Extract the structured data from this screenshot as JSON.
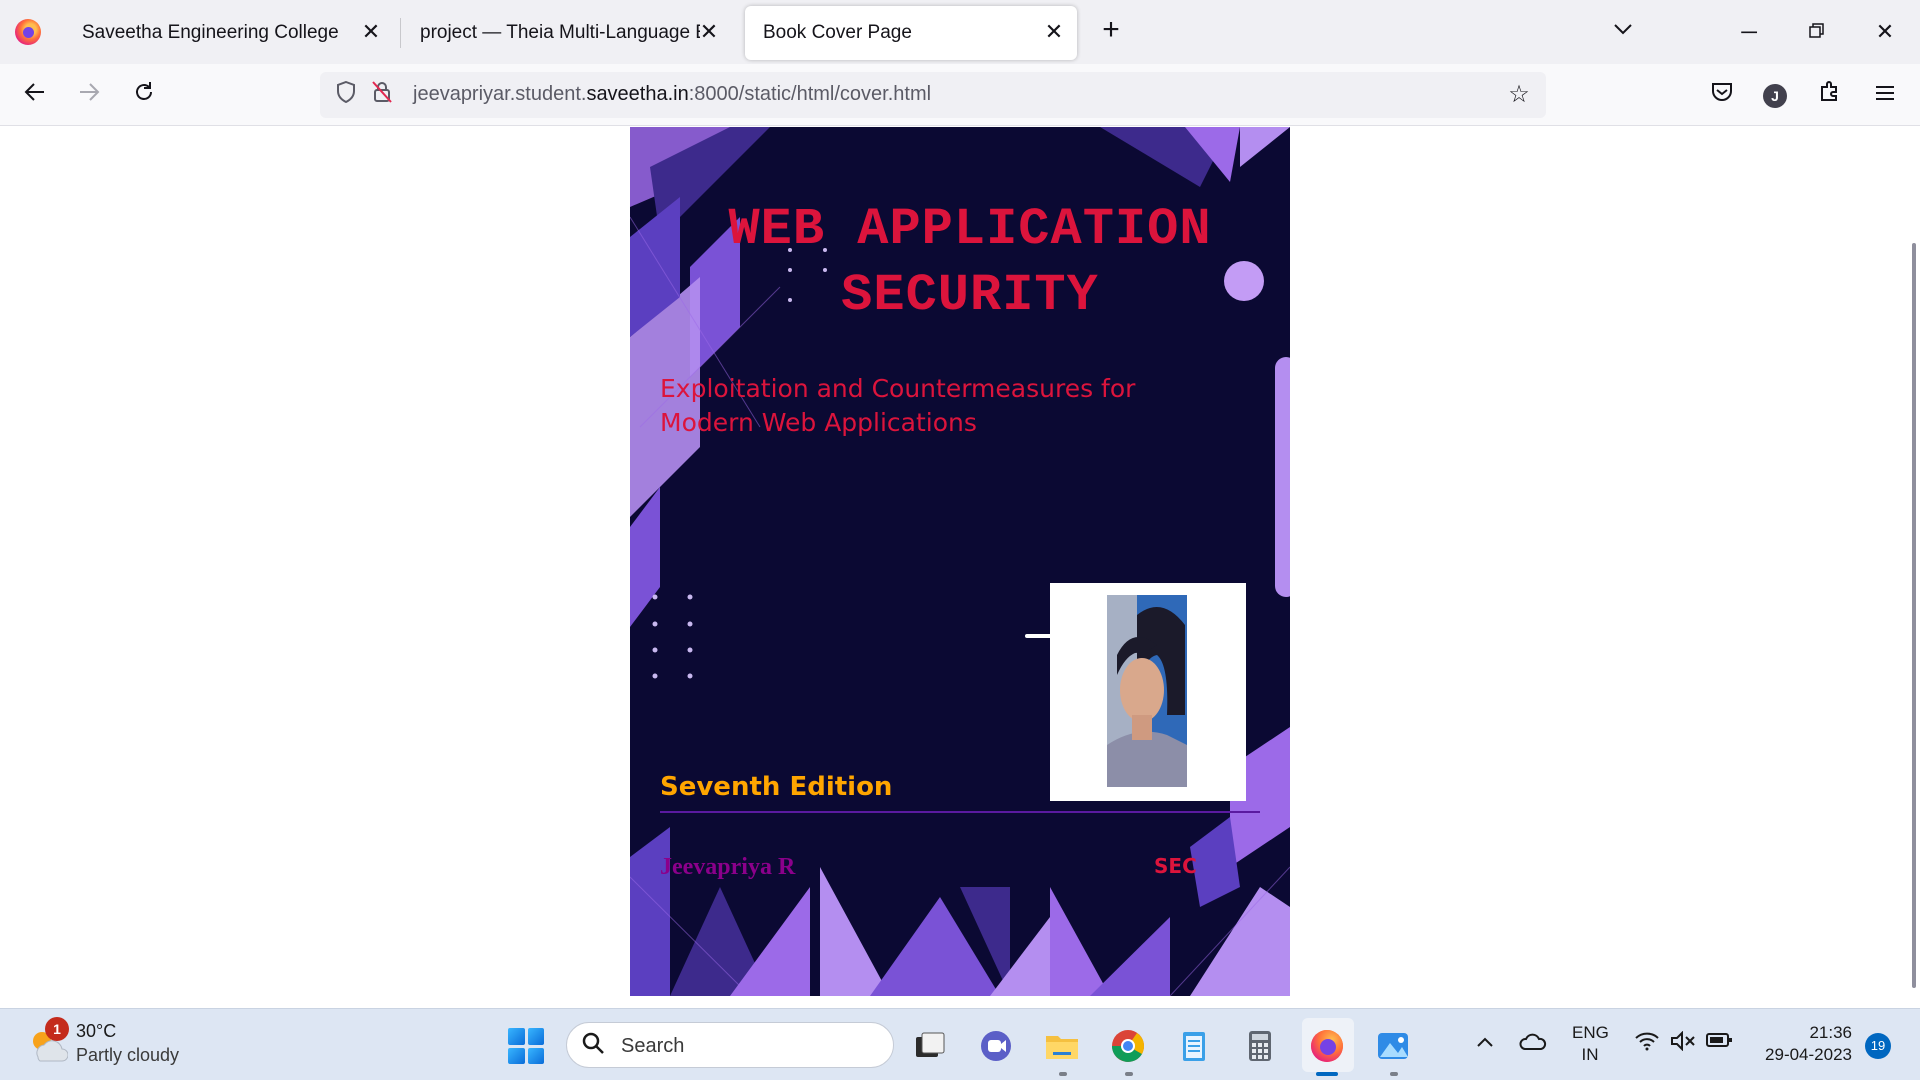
{
  "browser": {
    "tabs": [
      {
        "title": "Saveetha Engineering College",
        "active": false
      },
      {
        "title": "project — Theia Multi-Language Ex",
        "active": false
      },
      {
        "title": "Book Cover Page",
        "active": true
      }
    ],
    "url_prefix": "jeevapriyar.student.",
    "url_domain": "saveetha.in",
    "url_suffix": ":8000/static/html/cover.html",
    "profile_initial": "J"
  },
  "cover": {
    "title": "WEB APPLICATION SECURITY",
    "subtitle": "Exploitation and Countermeasures for Modern Web Applications",
    "edition": "Seventh Edition",
    "author": "Jeevapriya R",
    "publisher": "SEC",
    "colors": {
      "background": "#0b0933",
      "title": "#dc143c",
      "edition": "#ffa500",
      "author": "#8b008b",
      "accent": "#9c6ae8"
    }
  },
  "taskbar": {
    "weather_temp": "30°C",
    "weather_desc": "Partly cloudy",
    "weather_badge": "1",
    "search_placeholder": "Search",
    "lang_top": "ENG",
    "lang_bottom": "IN",
    "time": "21:36",
    "date": "29-04-2023",
    "notification_count": "19"
  }
}
